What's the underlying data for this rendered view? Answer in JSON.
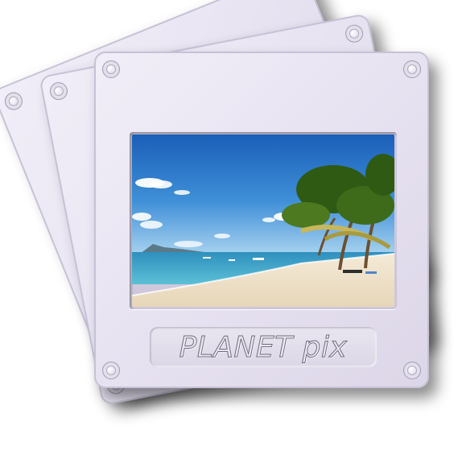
{
  "brand": {
    "label": "PLANET pix"
  },
  "photo": {
    "subject": "tropical-beach-scene"
  },
  "colors": {
    "slide_face": "#e6e1f0",
    "slide_border": "#c7c1d6",
    "sky_top": "#1a5fb8",
    "sea": "#3fa3c6",
    "sand": "#f0e4cf",
    "palm_green": "#3d6b1a"
  }
}
